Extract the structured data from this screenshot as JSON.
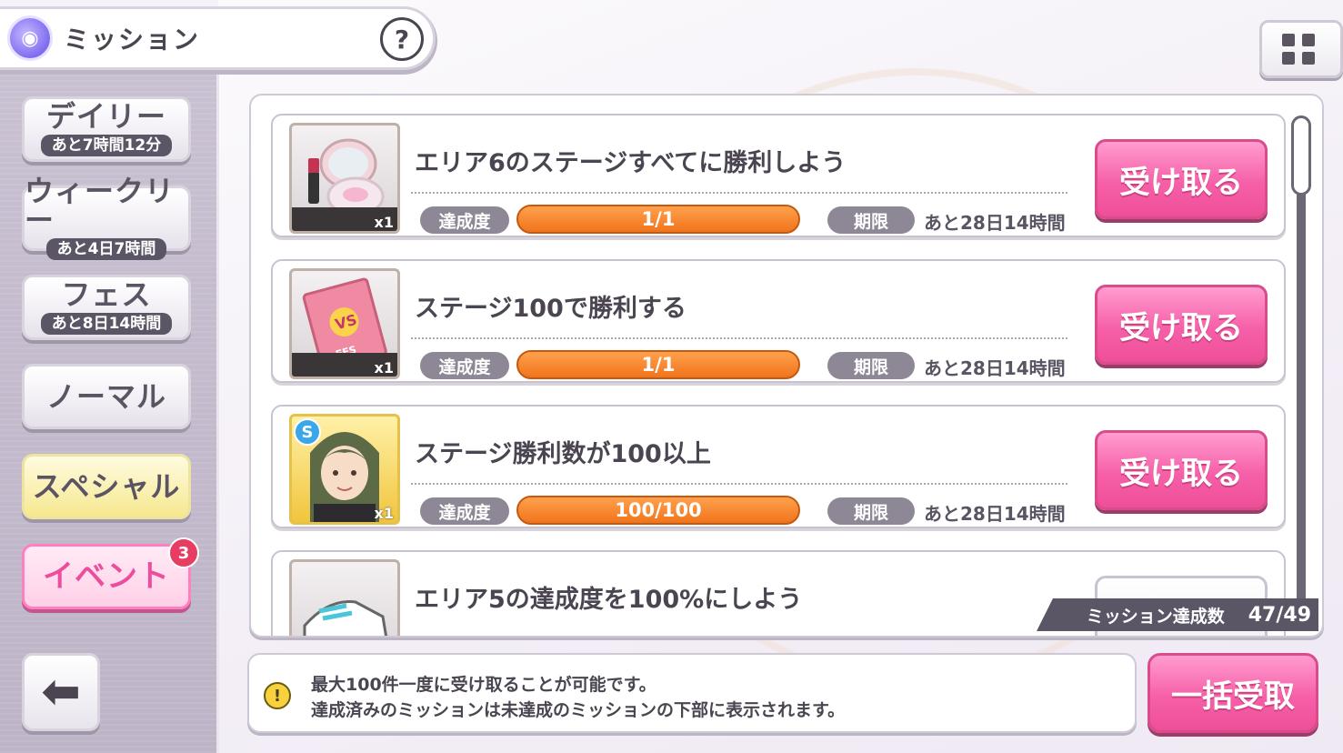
{
  "header": {
    "title": "ミッション",
    "help": "?"
  },
  "tabs": [
    {
      "label": "デイリー",
      "sub": "あと7時間12分"
    },
    {
      "label": "ウィークリー",
      "sub": "あと4日7時間"
    },
    {
      "label": "フェス",
      "sub": "あと8日14時間"
    },
    {
      "label": "ノーマル"
    },
    {
      "label": "スペシャル"
    },
    {
      "label": "イベント",
      "badge": "3"
    }
  ],
  "labels": {
    "progress": "達成度",
    "deadline": "期限",
    "claim": "受け取る"
  },
  "missions": [
    {
      "title": "エリア6のステージすべてに勝利しよう",
      "qty": "x1",
      "progress": "1/1",
      "deadline": "あと28日14時間",
      "reward_icon": "compact-mirror-lipstick-icon"
    },
    {
      "title": "ステージ100で勝利する",
      "qty": "x1",
      "progress": "1/1",
      "deadline": "あと28日14時間",
      "reward_icon": "fes-ticket-icon"
    },
    {
      "title": "ステージ勝利数が100以上",
      "qty": "x1",
      "progress": "100/100",
      "deadline": "あと28日14時間",
      "reward_icon": "character-portrait-icon",
      "rarity": "S"
    },
    {
      "title": "エリア5の達成度を100%にしよう",
      "reward_icon": "sneaker-icon"
    }
  ],
  "summary": {
    "label": "ミッション達成数",
    "value": "47/49"
  },
  "info": {
    "line1": "最大100件一度に受け取ることが可能です。",
    "line2": "達成済みのミッションは未達成のミッションの下部に表示されます。"
  },
  "bulk_claim": "一括受取",
  "colors": {
    "accent_pink": "#f660a8",
    "progress_orange": "#f1741b",
    "rail": "#c4bccd"
  }
}
